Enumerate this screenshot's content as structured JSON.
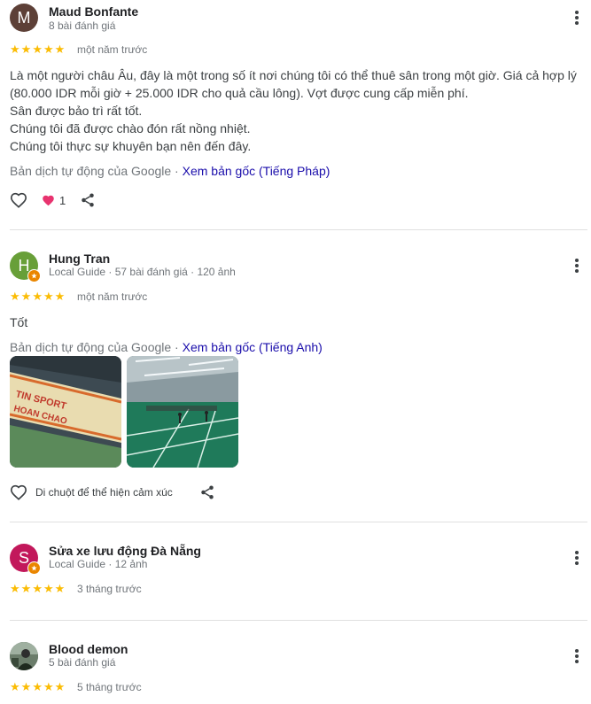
{
  "colors": {
    "star": "#fbbc04",
    "link": "#1a0dab",
    "muted": "#70757a",
    "guide_badge": "#ea8600"
  },
  "reviews": [
    {
      "initial": "M",
      "avatar_color": "#5d4037",
      "name": "Maud Bonfante",
      "meta": "8 bài đánh giá",
      "rating": 5,
      "time": "một năm trước",
      "body": [
        "Là một người châu Âu, đây là một trong số ít nơi chúng tôi có thể thuê sân trong một giờ. Giá cả hợp lý (80.000 IDR mỗi giờ + 25.000 IDR cho quả cầu lông). Vợt được cung cấp miễn phí.",
        "Sân được bảo trì rất tốt.",
        "Chúng tôi đã được chào đón rất nồng nhiệt.",
        "Chúng tôi thực sự khuyên bạn nên đến đây."
      ],
      "translation_note": "Bản dịch tự động của Google · ",
      "translation_link": "Xem bản gốc (Tiếng Pháp)",
      "reaction_count": "1",
      "icons": [
        "heart-outline-icon",
        "heart-reaction-icon",
        "share-icon",
        "more-vert-icon"
      ]
    },
    {
      "initial": "H",
      "avatar_color": "#689f38",
      "name": "Hung Tran",
      "meta": "Local Guide · 57 bài đánh giá · 120 ảnh",
      "rating": 5,
      "time": "một năm trước",
      "body": [
        "Tốt"
      ],
      "translation_note": "Bản dịch tự động của Google · ",
      "translation_link": "Xem bản gốc (Tiếng Anh)",
      "photos": [
        "banner-photo",
        "court-photo"
      ],
      "hover_hint": "Di chuột để thể hiện cảm xúc",
      "icons": [
        "heart-outline-icon",
        "share-icon",
        "more-vert-icon",
        "local-guide-badge-icon"
      ]
    },
    {
      "initial": "S",
      "avatar_color": "#c2185b",
      "name": "Sửa xe lưu động Đà Nẵng",
      "meta": "Local Guide · 12 ảnh",
      "rating": 5,
      "time": "3 tháng trước",
      "icons": [
        "more-vert-icon",
        "local-guide-badge-icon"
      ]
    },
    {
      "initial": "",
      "avatar_color": "#4a5a4a",
      "name": "Blood demon",
      "meta": "5 bài đánh giá",
      "rating": 5,
      "time": "5 tháng trước",
      "icons": [
        "more-vert-icon",
        "photo-avatar"
      ]
    }
  ]
}
